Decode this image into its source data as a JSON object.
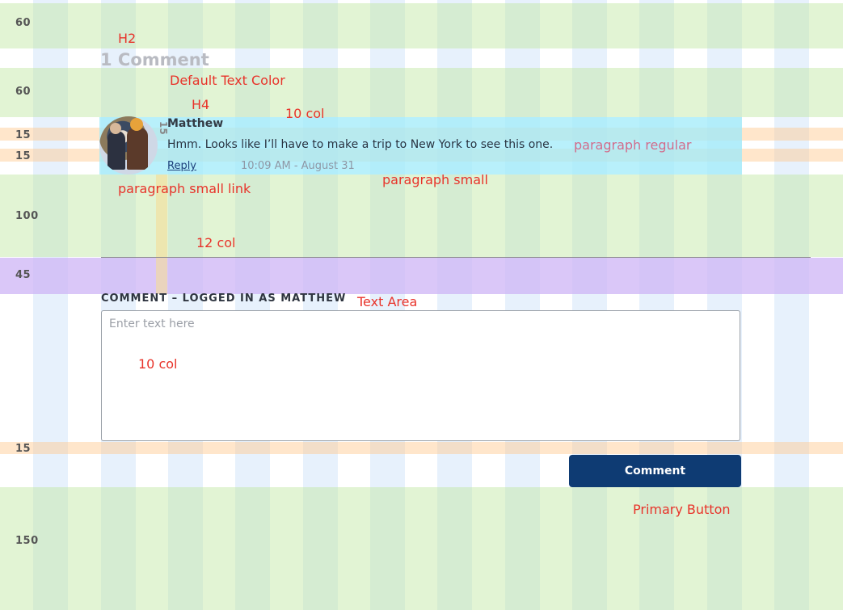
{
  "bands": {
    "top": "60",
    "gap1": "60",
    "gap2": "15",
    "gap3": "15",
    "gap4": "100",
    "gap5": "45",
    "gap6": "15",
    "bottom": "150"
  },
  "annotations": {
    "h2": "H2",
    "default_text_color": "Default Text Color",
    "h4": "H4",
    "ten_col_top": "10 col",
    "paragraph_regular": "paragraph regular",
    "paragraph_small_link": "paragraph small link",
    "paragraph_small": "paragraph small",
    "twelve_col": "12 col",
    "text_area": "Text Area",
    "ten_col_textarea": "10 col",
    "primary_button": "Primary Button",
    "spacing_15_vertical": "15"
  },
  "comments": {
    "heading": "1 Comment",
    "author": "Matthew",
    "text": "Hmm. Looks like I’ll have to make a trip to New York to see this one.",
    "reply": "Reply",
    "timestamp": "10:09 AM - August 31"
  },
  "form": {
    "label": "COMMENT – LOGGED IN AS MATTHEW",
    "placeholder": "Enter text here",
    "submit": "Comment"
  },
  "colors": {
    "grid_column": "#bcd8f5",
    "band_green": "#c9e8b4",
    "band_orange": "#ffd3a6",
    "band_purple": "#d8c8f4",
    "comment_highlight": "#a8ecf8",
    "annotation": "#e8332a",
    "button": "#0e3b73"
  }
}
